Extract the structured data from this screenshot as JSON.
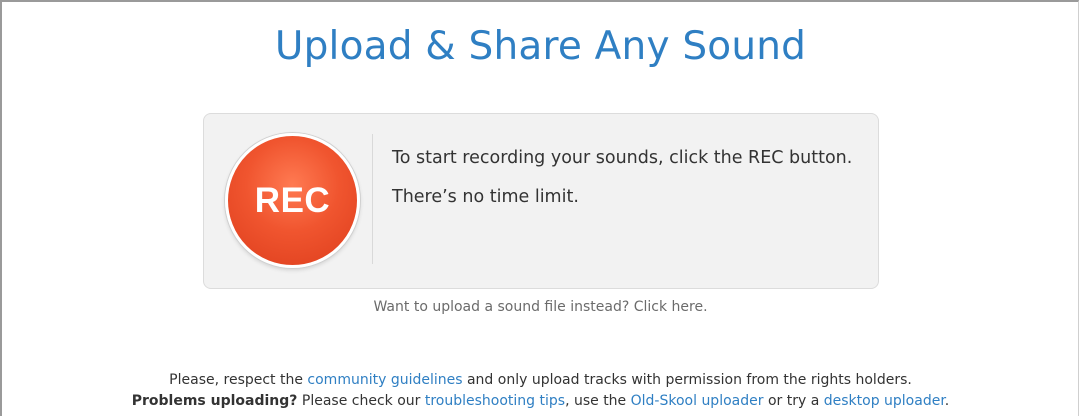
{
  "page": {
    "title": "Upload & Share Any Sound"
  },
  "recorder": {
    "button_label": "REC",
    "line1": "To start recording your sounds, click the REC button.",
    "line2": "There’s no time limit."
  },
  "upload_alt": {
    "text": "Want to upload a sound file instead? Click here."
  },
  "notice": {
    "line1_prefix": "Please, respect the ",
    "line1_link": "community guidelines",
    "line1_suffix": " and only upload tracks with permission from the rights holders.",
    "line2_bold": "Problems uploading?",
    "line2_a": " Please check our ",
    "line2_link1": "troubleshooting tips",
    "line2_b": ", use the ",
    "line2_link2": "Old-Skool uploader",
    "line2_c": " or try a ",
    "line2_link3": "desktop uploader",
    "line2_d": "."
  },
  "colors": {
    "accent": "#2f7fc3",
    "rec": "#f0552f"
  }
}
